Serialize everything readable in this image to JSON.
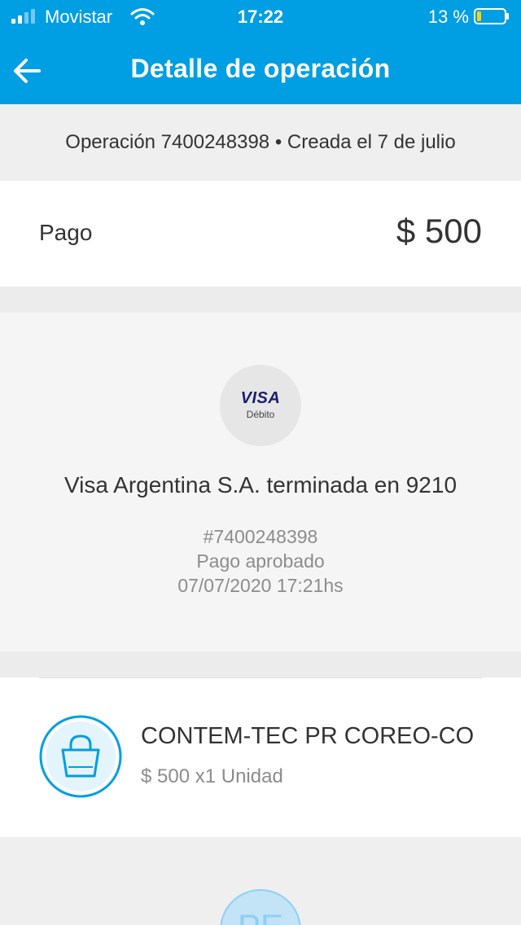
{
  "status_bar": {
    "carrier": "Movistar",
    "time": "17:22",
    "battery": "13 %"
  },
  "header": {
    "title": "Detalle de operación"
  },
  "operation": {
    "summary": "Operación 7400248398 • Creada el 7 de julio"
  },
  "payment": {
    "label": "Pago",
    "amount": "$ 500"
  },
  "method": {
    "brand": "VISA",
    "brand_sub": "Débito",
    "card_name": "Visa Argentina S.A. terminada en 9210",
    "reference": "#7400248398",
    "status": "Pago aprobado",
    "datetime": "07/07/2020 17:21hs"
  },
  "item": {
    "title": "CONTEM-TEC PR COREO-CO",
    "subtitle": "$ 500 x1 Unidad"
  },
  "seller": {
    "initials": "PE"
  },
  "colors": {
    "brand_blue": "#009ee3",
    "visa_navy": "#1a1f71"
  }
}
